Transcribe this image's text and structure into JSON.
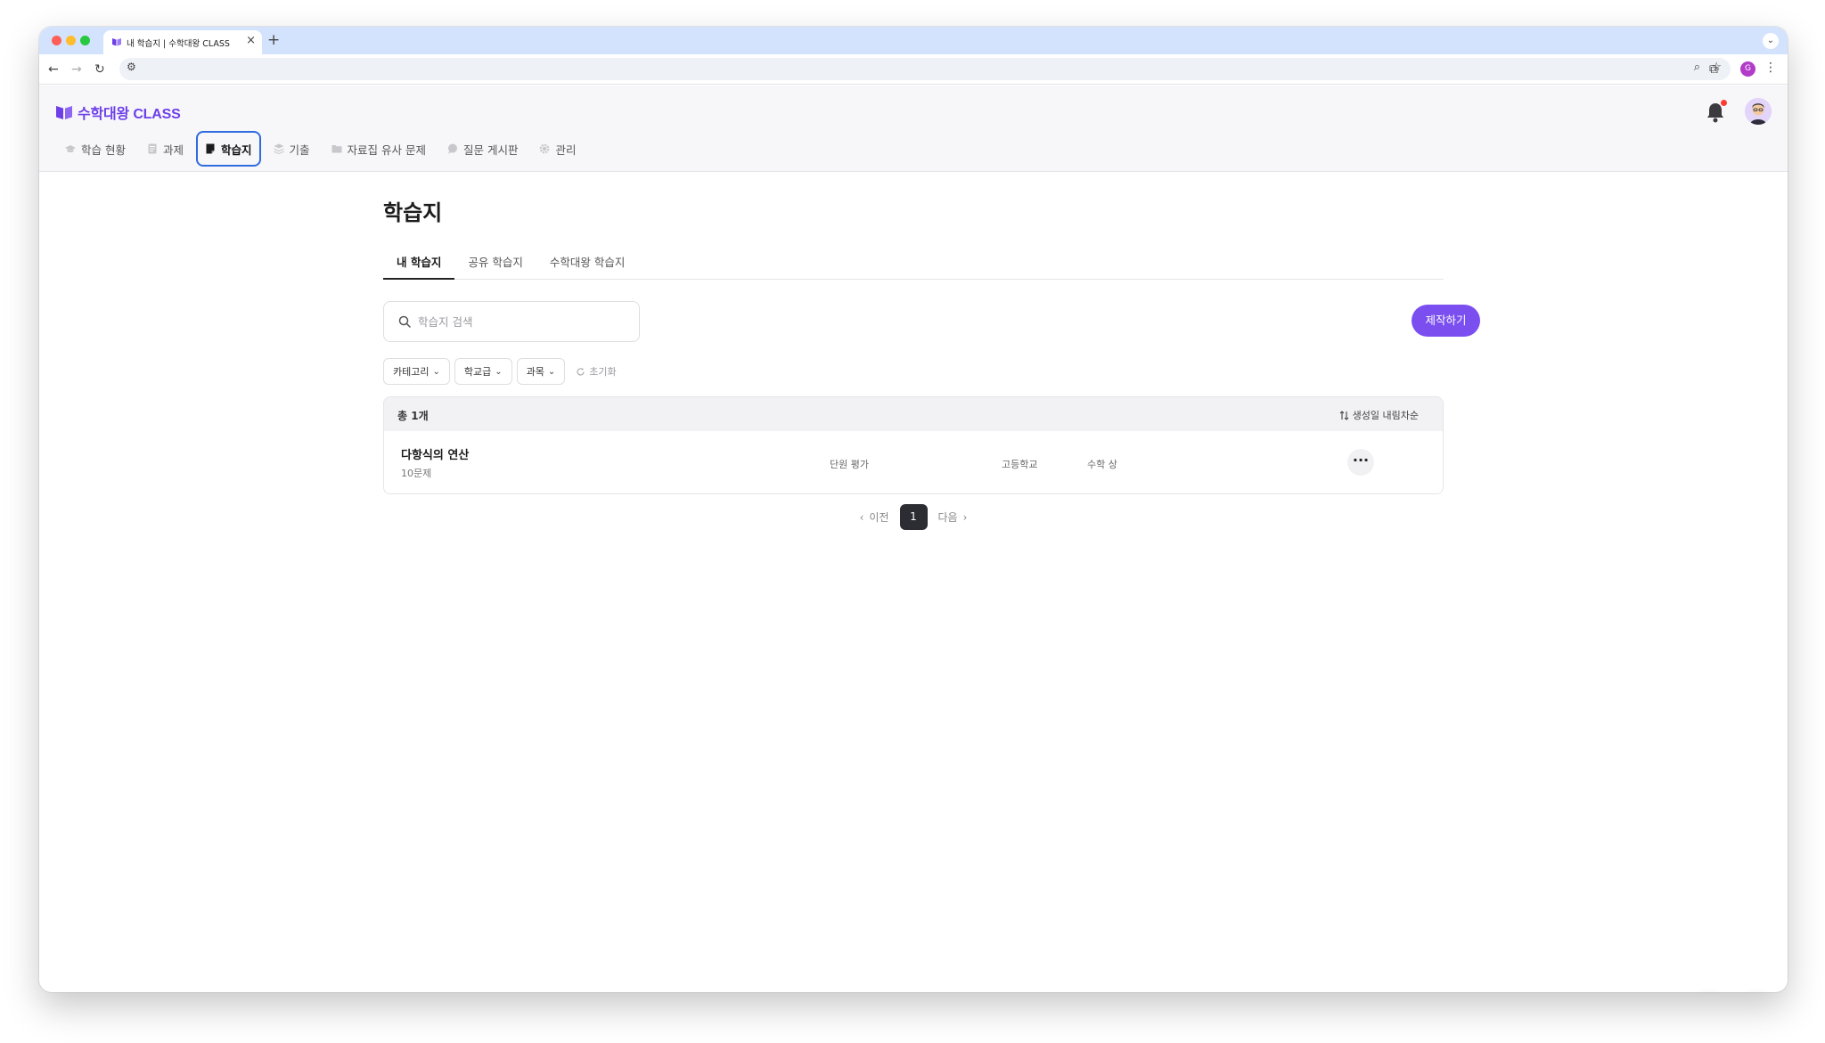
{
  "browser": {
    "tab_title": "내 학습지 | 수학대왕 CLASS",
    "tab_close": "×",
    "new_tab": "+",
    "tab_menu": "⌄",
    "profile_initial": "G"
  },
  "app": {
    "brand": "수학대왕 CLASS",
    "nav": [
      {
        "label": "학습 현황",
        "icon": "graduation-cap-icon"
      },
      {
        "label": "과제",
        "icon": "document-icon"
      },
      {
        "label": "학습지",
        "icon": "notebook-icon",
        "active": true
      },
      {
        "label": "기출",
        "icon": "stack-icon"
      },
      {
        "label": "자료집 유사 문제",
        "icon": "folder-icon"
      },
      {
        "label": "질문 게시판",
        "icon": "chat-bubble-icon"
      },
      {
        "label": "관리",
        "icon": "gear-icon"
      }
    ]
  },
  "page": {
    "title": "학습지",
    "subtabs": [
      "내 학습지",
      "공유 학습지",
      "수학대왕 학습지"
    ],
    "search_placeholder": "학습지 검색",
    "create_label": "제작하기",
    "filters": [
      "카테고리",
      "학교급",
      "과목"
    ],
    "reset_label": "초기화",
    "total_label": "총 1개",
    "sort_label": "생성일 내림차순",
    "rows": [
      {
        "title": "다항식의 연산",
        "count": "10문제",
        "category": "단원 평가",
        "school": "고등학교",
        "subject": "수학 상",
        "more": "···"
      }
    ],
    "pagination": {
      "prev": "이전",
      "current": "1",
      "next": "다음"
    }
  },
  "colors": {
    "accent": "#7b4ef0",
    "brand": "#6d3fe8",
    "active_outline": "#2f6bde",
    "badge": "#ff3b30"
  }
}
